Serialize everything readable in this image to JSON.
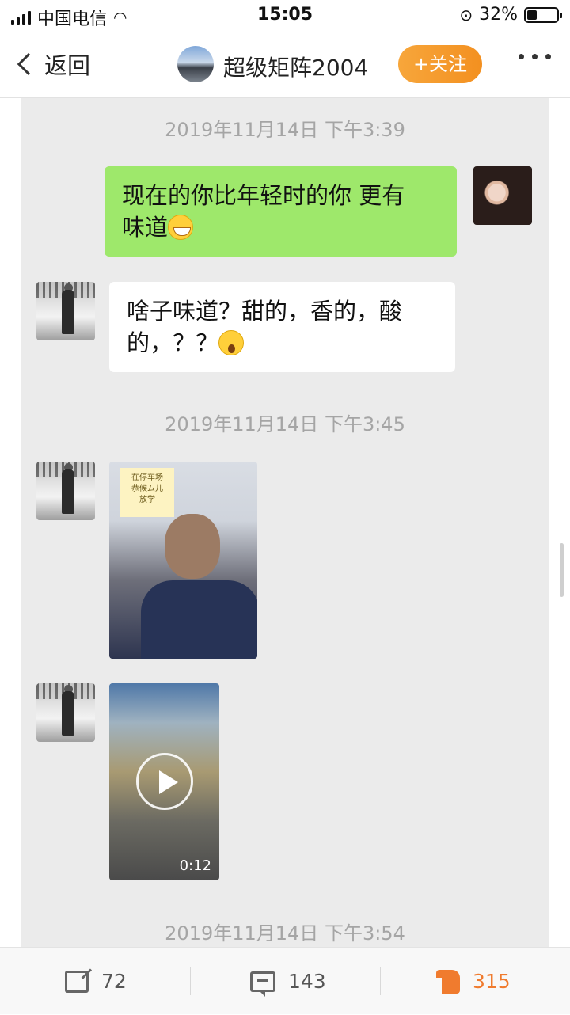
{
  "status_bar": {
    "carrier": "中国电信",
    "time": "15:05",
    "battery_pct": "32%",
    "battery_level": 0.32
  },
  "nav": {
    "back_label": "返回",
    "title": "超级矩阵2004",
    "follow_label": "+关注"
  },
  "chat": {
    "timestamps": [
      "2019年11月14日 下午3:39",
      "2019年11月14日 下午3:45",
      "2019年11月14日 下午3:54"
    ],
    "messages": [
      {
        "side": "right",
        "text_line1": "现在的你比年轻时的你 更有",
        "text_line2": "味道",
        "emoji": "grinning-face"
      },
      {
        "side": "left",
        "text_line1": "啥子味道？甜的，香的，酸",
        "text_line2": "的，？？",
        "emoji": "astonished-face"
      },
      {
        "side": "left",
        "type": "image",
        "sticker_line1": "在停车场",
        "sticker_line2": "恭候ム儿",
        "sticker_line3": "放学"
      },
      {
        "side": "left",
        "type": "video",
        "duration": "0:12"
      }
    ]
  },
  "bottom_bar": {
    "share_count": "72",
    "comment_count": "143",
    "like_count": "315"
  },
  "colors": {
    "accent": "#f39020",
    "bubble_green": "#9ee86b",
    "like": "#f07b2e"
  }
}
